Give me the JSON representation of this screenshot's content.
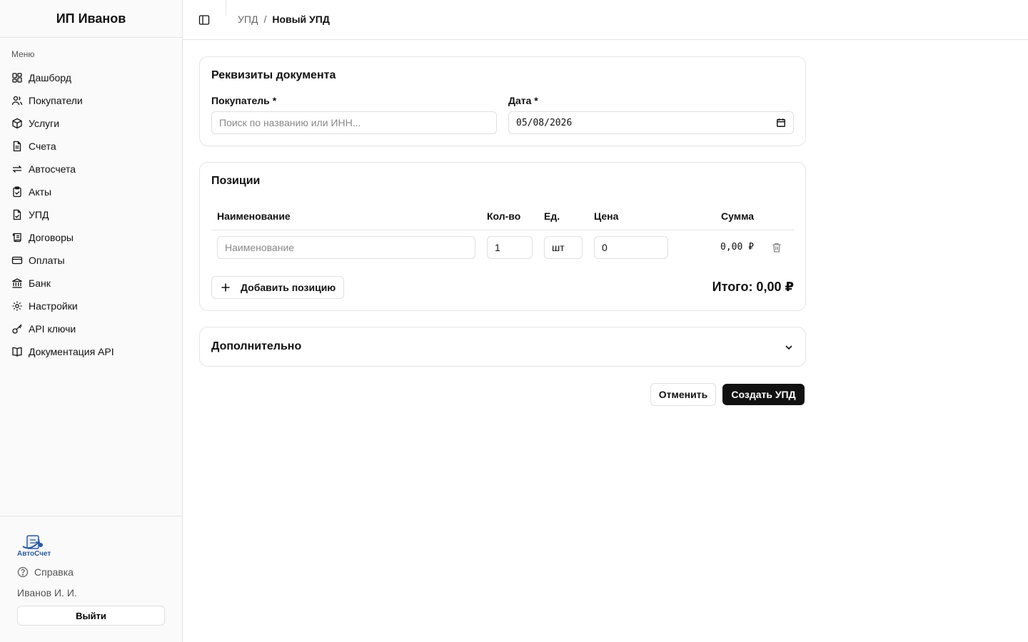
{
  "sidebar": {
    "brand": "ИП Иванов",
    "menu_label": "Меню",
    "items": [
      {
        "label": "Дашборд",
        "icon": "dashboard-icon"
      },
      {
        "label": "Покупатели",
        "icon": "users-icon"
      },
      {
        "label": "Услуги",
        "icon": "package-icon"
      },
      {
        "label": "Счета",
        "icon": "file-text-icon"
      },
      {
        "label": "Автосчета",
        "icon": "repeat-icon"
      },
      {
        "label": "Акты",
        "icon": "clipboard-check-icon"
      },
      {
        "label": "УПД",
        "icon": "file-check-icon"
      },
      {
        "label": "Договоры",
        "icon": "scroll-icon"
      },
      {
        "label": "Оплаты",
        "icon": "credit-card-icon"
      },
      {
        "label": "Банк",
        "icon": "bank-icon"
      },
      {
        "label": "Настройки",
        "icon": "gear-icon"
      },
      {
        "label": "API ключи",
        "icon": "key-icon"
      },
      {
        "label": "Документация API",
        "icon": "book-icon"
      }
    ],
    "logo_text": "АвтоСчет",
    "help_label": "Справка",
    "user_name": "Иванов И. И.",
    "logout_label": "Выйти"
  },
  "header": {
    "breadcrumb_parent": "УПД",
    "breadcrumb_sep": "/",
    "breadcrumb_current": "Новый УПД"
  },
  "requisites": {
    "title": "Реквизиты документа",
    "buyer_label": "Покупатель",
    "buyer_placeholder": "Поиск по названию или ИНН...",
    "date_label": "Дата",
    "date_value": "05/08/2026",
    "required_mark": "*"
  },
  "positions": {
    "title": "Позиции",
    "columns": {
      "name": "Наименование",
      "qty": "Кол-во",
      "unit": "Ед.",
      "price": "Цена",
      "sum": "Сумма"
    },
    "rows": [
      {
        "name_placeholder": "Наименование",
        "qty": "1",
        "unit": "шт",
        "price": "0",
        "sum": "0,00 ₽"
      }
    ],
    "add_label": "Добавить позицию",
    "total": "Итого: 0,00 ₽"
  },
  "additional": {
    "title": "Дополнительно"
  },
  "actions": {
    "cancel_label": "Отменить",
    "create_label": "Создать УПД"
  },
  "colors": {
    "accent": "#111111",
    "border": "#e5e5e5",
    "sidebar_bg": "#fafafa",
    "logo_blue": "#2b5aa3"
  }
}
